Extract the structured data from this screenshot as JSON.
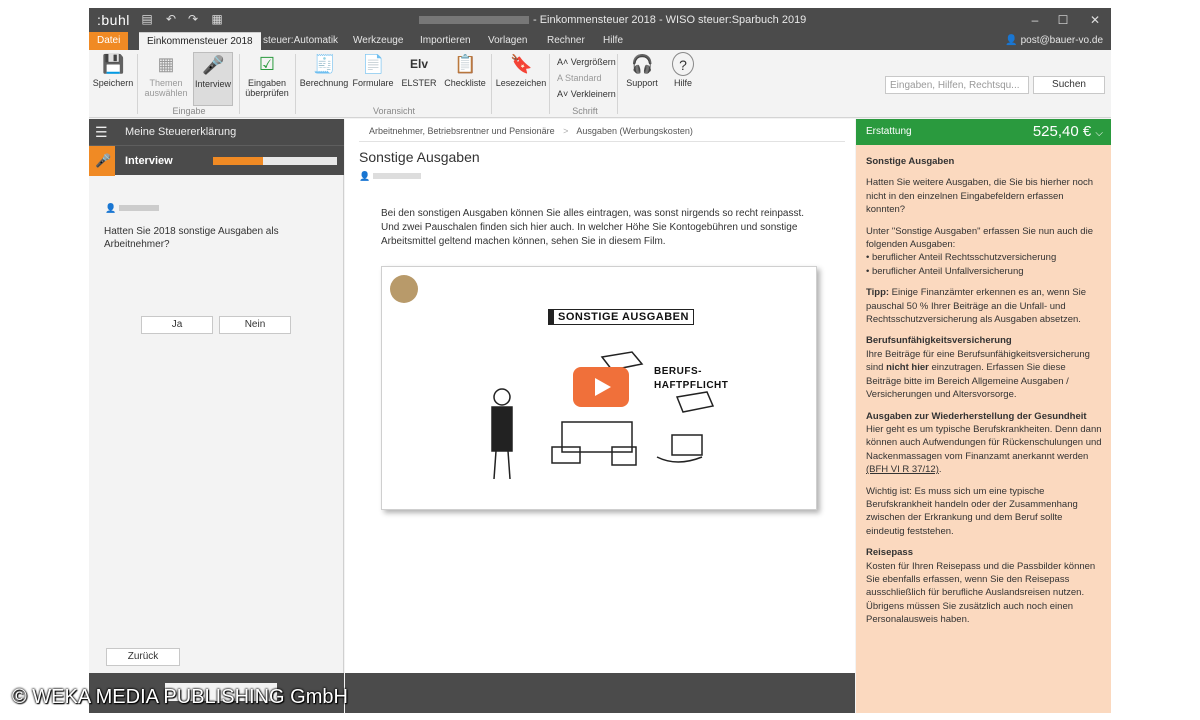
{
  "titlebar": {
    "brand": ":buhl",
    "window_title": "- Einkommensteuer 2018 - WISO steuer:Sparbuch 2019"
  },
  "tabs": [
    {
      "label": "Datei"
    },
    {
      "label": "Einkommensteuer 2018"
    },
    {
      "label": "steuer:Automatik"
    },
    {
      "label": "Werkzeuge"
    },
    {
      "label": "Importieren"
    },
    {
      "label": "Vorlagen"
    },
    {
      "label": "Rechner"
    },
    {
      "label": "Hilfe"
    }
  ],
  "user_email": "post@bauer-vo.de",
  "ribbon": {
    "speichern": "Speichern",
    "themen": "Themen auswählen",
    "interview": "Interview",
    "eingaben_pruefen": "Eingaben überprüfen",
    "berechnung": "Berechnung",
    "formulare": "Formulare",
    "elster": "ELSTER",
    "checkliste": "Checkliste",
    "lesezeichen": "Lesezeichen",
    "vergroessern": "Vergrößern",
    "standard": "Standard",
    "verkleinern": "Verkleinern",
    "support": "Support",
    "hilfe": "Hilfe",
    "group_eingabe": "Eingabe",
    "group_voransicht": "Voransicht",
    "group_schrift": "Schrift",
    "search_placeholder": "Eingaben, Hilfen, Rechtsqu...",
    "search_button": "Suchen"
  },
  "left": {
    "header": "Meine Steuererklärung",
    "interview": "Interview",
    "progress": 0.4,
    "question": "Hatten Sie 2018 sonstige Ausgaben als Arbeitnehmer?",
    "yes": "Ja",
    "no": "Nein",
    "back": "Zurück"
  },
  "middle": {
    "breadcrumb_1": "Arbeitnehmer, Betriebsrentner und Pensionäre",
    "breadcrumb_sep": ">",
    "breadcrumb_2": "Ausgaben (Werbungskosten)",
    "title": "Sonstige Ausgaben",
    "intro": "Bei den sonstigen Ausgaben können Sie alles eintragen, was sonst nirgends so recht reinpasst. Und zwei Pauschalen finden sich hier auch. In welcher Höhe Sie Kontogebühren und sonstige Arbeitsmittel geltend machen können, sehen Sie in diesem Film.",
    "video_title": "SONSTIGE AUSGABEN",
    "video_text_1": "BERUFS-",
    "video_text_2": "HAFTPFLICHT"
  },
  "right": {
    "label": "Erstattung",
    "amount": "525,40 €",
    "h1": "Sonstige Ausgaben",
    "p1": "Hatten Sie weitere Ausgaben, die Sie bis hierher noch nicht in den einzelnen Eingabefeldern erfassen konnten?",
    "p2": "Unter \"Sonstige Ausgaben\" erfassen Sie nun auch die folgenden Ausgaben:",
    "li1": "beruflicher Anteil Rechtsschutzversicherung",
    "li2": "beruflicher Anteil Unfallversicherung",
    "tipp_label": "Tipp:",
    "tipp": " Einige Finanzämter erkennen es an, wenn Sie pauschal 50 % Ihrer Beiträge an die Unfall- und Rechtsschutzversicherung als Ausgaben absetzen.",
    "h2": "Berufsunfähigkeitsversicherung",
    "p3a": "Ihre Beiträge für eine Berufsunfähigkeitsversicherung sind ",
    "p3b": "nicht hier",
    "p3c": " einzutragen. Erfassen Sie diese Beiträge bitte im Bereich Allgemeine Ausgaben / Versicherungen und Altersvorsorge.",
    "h3": "Ausgaben zur Wiederherstellung der Gesundheit",
    "p4": "Hier geht es um typische Berufskrankheiten. Denn dann können auch Aufwendungen für Rückenschulungen und Nackenmassagen vom Finanzamt anerkannt werden ",
    "p4_link": "(BFH VI R 37/12)",
    "p4_end": ".",
    "p5": "Wichtig ist: Es muss sich um eine typische Berufskrankheit handeln oder der Zusammenhang zwischen der Erkrankung und dem Beruf sollte eindeutig feststehen.",
    "h4": "Reisepass",
    "p6": "Kosten für Ihren Reisepass und die Passbilder können Sie ebenfalls erfassen, wenn Sie den Reisepass ausschließlich für berufliche Auslandsreisen nutzen. Übrigens müssen Sie zusätzlich auch noch einen Personalausweis haben."
  },
  "watermark": "© WEKA MEDIA PUBLISHING GmbH",
  "colors": {
    "accent": "#f08a24",
    "refund": "#2a9a3e",
    "help_bg": "#fbd9bf",
    "dark": "#4b4b4b"
  }
}
